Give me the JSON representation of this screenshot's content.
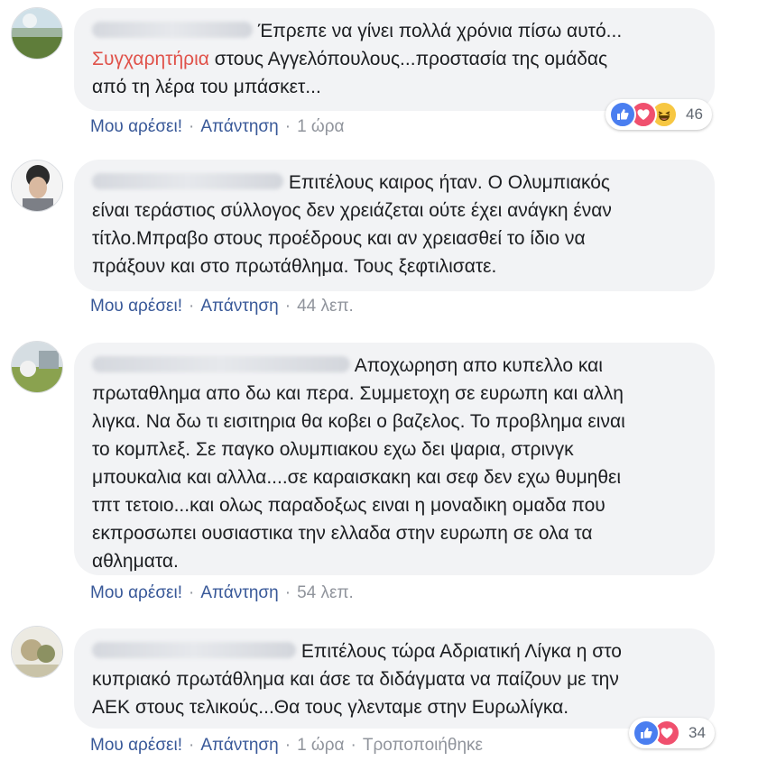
{
  "comments": [
    {
      "lines": [
        "Έπρεπε να γίνει πολλά χρόνια πίσω αυτό...",
        "στους Αγγελόπουλους...προστασία της ομάδας",
        "από τη λέρα του μπάσκετ..."
      ],
      "highlight": "Συγχαρητήρια",
      "like": "Μου αρέσει!",
      "reply": "Απάντηση",
      "time": "1 ώρα",
      "reactions": {
        "types": [
          "like-icon",
          "love-icon",
          "haha-icon"
        ],
        "count": "46"
      }
    },
    {
      "lines": [
        "Επιτέλους καιρος ήταν. Ο Ολυμπιακός",
        "είναι τεράστιος σύλλογος δεν χρειάζεται ούτε έχει ανάγκη έναν",
        "τίτλο.Μπραβο στους προέδρους και αν χρειασθεί το ίδιο να",
        "πράξουν και στο πρωτάθλημα. Τους ξεφτιλισατε."
      ],
      "like": "Μου αρέσει!",
      "reply": "Απάντηση",
      "time": "44 λεπ."
    },
    {
      "lines": [
        "Αποχωρηση απο κυπελλο και",
        "πρωταθλημα απο δω και περα. Συμμετοχη σε ευρωπη και αλλη",
        "λιγκα. Να δω τι εισιτηρια θα κοβει ο βαζελος. Το προβλημα ειναι",
        "το κομπλεξ. Σε παγκο ολυμπιακου εχω δει ψαρια, στρινγκ",
        "μπουκαλια και αλλλα....σε καραισκακη και σεφ δεν εχω θυμηθει",
        "τπτ τετοιο...και ολως παραδοξως ειναι η μοναδικη ομαδα που",
        "εκπροσωπει ουσιαστικα την ελλαδα στην ευρωπη σε ολα τα",
        "αθληματα."
      ],
      "like": "Μου αρέσει!",
      "reply": "Απάντηση",
      "time": "54 λεπ."
    },
    {
      "lines": [
        "Επιτέλους τώρα Αδριατική Λίγκα η στο",
        "κυπριακό πρωτάθλημα και άσε τα διδάγματα να παίζουν με την",
        "ΑΕΚ στους τελικούς...Θα τους γλενταμε στην Ευρωλίγκα."
      ],
      "like": "Μου αρέσει!",
      "reply": "Απάντηση",
      "time": "1 ώρα",
      "edited": "Τροποποιήθηκε",
      "reactions": {
        "types": [
          "like-icon",
          "love-icon"
        ],
        "count": "34"
      }
    }
  ],
  "colors": {
    "bubble": "#f2f3f5",
    "link": "#385898",
    "meta": "#90949c",
    "highlight": "#e0524a",
    "like": "#4a7ef0",
    "love": "#f0506e",
    "haha": "#f7c742"
  }
}
